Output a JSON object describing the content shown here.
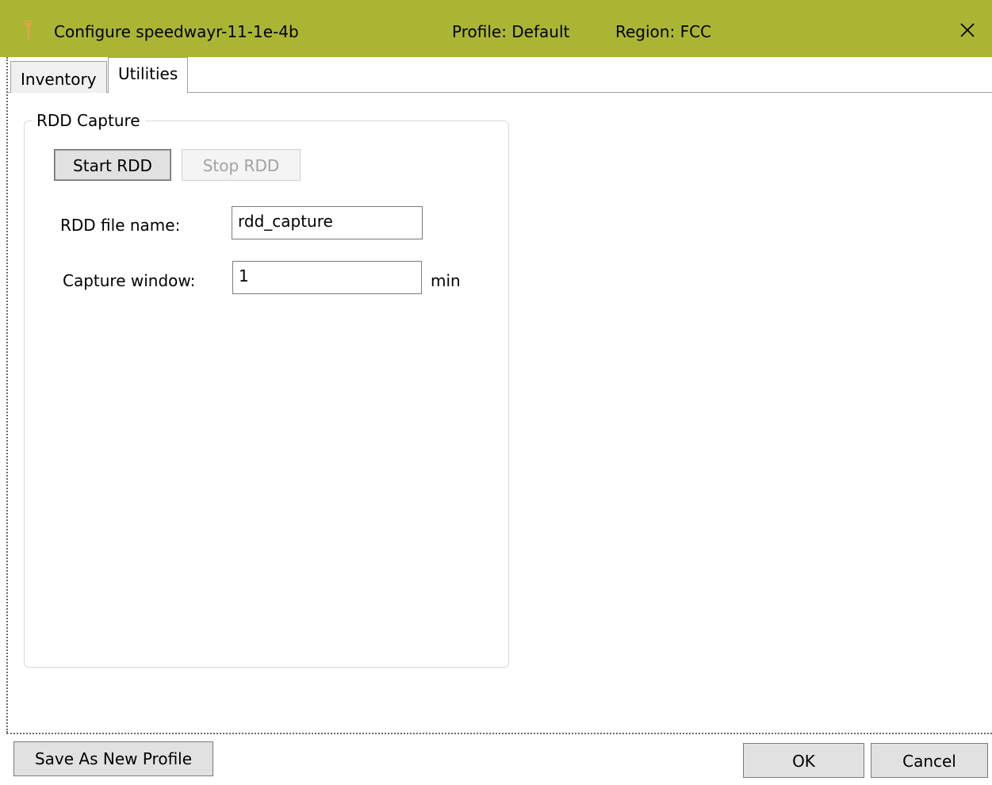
{
  "window": {
    "title": "Configure speedwayr-11-1e-4b",
    "profile": "Profile: Default",
    "region": "Region: FCC",
    "colors": {
      "titlebar": "#aab534",
      "icon": "#e8a24a"
    }
  },
  "tabs": [
    {
      "label": "Inventory",
      "selected": false
    },
    {
      "label": "Utilities",
      "selected": true
    }
  ],
  "rdd_capture": {
    "group_label": "RDD Capture",
    "start_button": "Start RDD",
    "stop_button": "Stop RDD",
    "file_name_label": "RDD file name:",
    "file_name_value": "rdd_capture",
    "capture_window_label": "Capture window:",
    "capture_window_value": "1",
    "capture_window_unit": "min"
  },
  "footer": {
    "save_profile_button": "Save As New Profile",
    "ok_button": "OK",
    "cancel_button": "Cancel"
  }
}
